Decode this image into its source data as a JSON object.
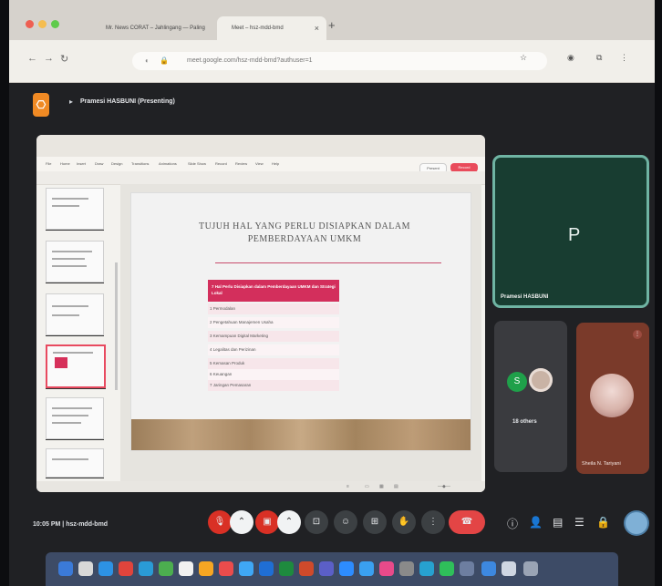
{
  "browser": {
    "tabs": [
      {
        "title": "Mr. News CORAT – Jahlingang — Paling"
      },
      {
        "title": "Meet – hsz-mdd-bmd"
      }
    ],
    "address": "meet.google.com/hsz-mdd-bmd?authuser=1",
    "new_tab_glyph": "+"
  },
  "meet": {
    "presenter_title": "Pramesi HASBUNI (Presenting)",
    "presenting_app": {
      "slide_title_line1": "TUJUH HAL YANG PERLU DISIAPKAN DALAM",
      "slide_title_line2": "PEMBERDAYAAN UMKM",
      "box_header": "7 Hal Perlu Disiapkan dalam Pemberdayaan UMKM dan Strategi Lokal",
      "rows": [
        "1 Permodalan",
        "2 Pengetahuan Manajemen Usaha",
        "3 Kemampuan Digital Marketing",
        "4 Legalitas dan Perizinan",
        "5 Kemasan Produk",
        "6 Keuangan",
        "7 Jaringan Pemasaran"
      ],
      "menu": [
        "File",
        "Home",
        "Insert",
        "Draw",
        "Design",
        "Transitions",
        "Animations",
        "Slide Show",
        "Record",
        "Review",
        "View",
        "Help"
      ],
      "record_label": "Record",
      "present_label": "Present"
    },
    "self_tile": {
      "letter": "P",
      "name": "Pramesi HASBUNI"
    },
    "others_tile": {
      "avatar_letter": "S",
      "label": "18 others"
    },
    "person_tile": {
      "name": "Sheila N. Tariyani"
    },
    "time_and_code": "10:05 PM | hsz-mdd-bmd"
  },
  "colors": {
    "accent_red": "#d32f5c",
    "meet_bg": "#202124",
    "self_tile": "#183d31"
  }
}
